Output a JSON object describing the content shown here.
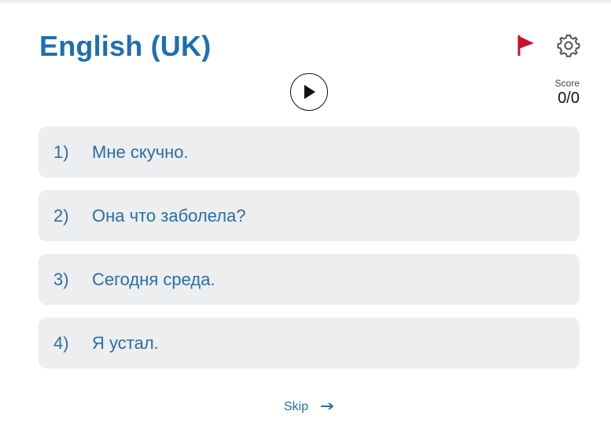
{
  "header": {
    "title": "English (UK)"
  },
  "score": {
    "label": "Score",
    "value": "0/0"
  },
  "options": [
    {
      "num": "1)",
      "text": "Мне скучно."
    },
    {
      "num": "2)",
      "text": "Она что заболела?"
    },
    {
      "num": "3)",
      "text": "Сегодня среда."
    },
    {
      "num": "4)",
      "text": "Я устал."
    }
  ],
  "footer": {
    "skip_label": "Skip"
  },
  "icons": {
    "flag": "flag-icon",
    "settings": "gear-icon",
    "play": "play-icon",
    "arrow": "arrow-right-icon"
  },
  "colors": {
    "title": "#1f6fb0",
    "option_text": "#2a6ea6",
    "option_bg": "#eceef0",
    "flag": "#c8102e"
  }
}
